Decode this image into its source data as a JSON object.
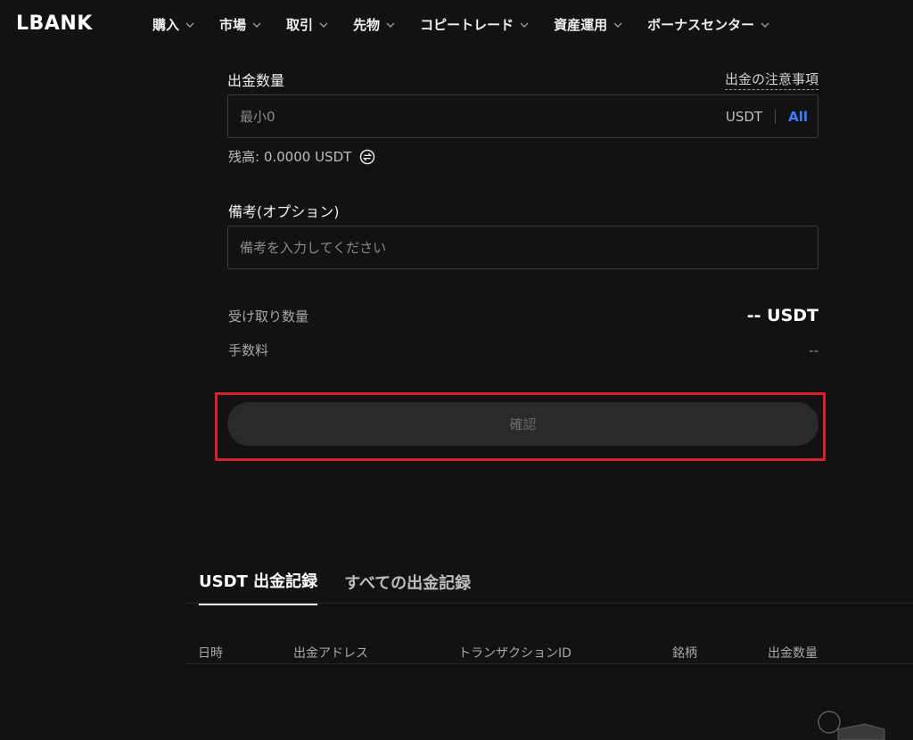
{
  "nav": {
    "logo": "LBANK",
    "items": [
      {
        "label": "購入"
      },
      {
        "label": "市場"
      },
      {
        "label": "取引"
      },
      {
        "label": "先物"
      },
      {
        "label": "コピートレード"
      },
      {
        "label": "資産運用"
      },
      {
        "label": "ボーナスセンター"
      }
    ]
  },
  "withdraw": {
    "amount_label": "出金数量",
    "notice_link": "出金の注意事項",
    "amount_placeholder": "最小0",
    "amount_value": "",
    "unit": "USDT",
    "all_label": "All",
    "balance": "残高: 0.0000 USDT"
  },
  "remark": {
    "label": "備考(オプション)",
    "placeholder": "備考を入力してください",
    "value": ""
  },
  "summary": {
    "receive_label": "受け取り数量",
    "receive_value": "-- USDT",
    "fee_label": "手数料",
    "fee_value": "--"
  },
  "confirm_label": "確認",
  "highlight_color": "#d8202a",
  "accent_color": "#3d7bff",
  "records": {
    "tabs": [
      {
        "label": "USDT 出金記録",
        "active": true
      },
      {
        "label": "すべての出金記録",
        "active": false
      }
    ],
    "columns": [
      "日時",
      "出金アドレス",
      "トランザクションID",
      "銘柄",
      "出金数量"
    ]
  }
}
